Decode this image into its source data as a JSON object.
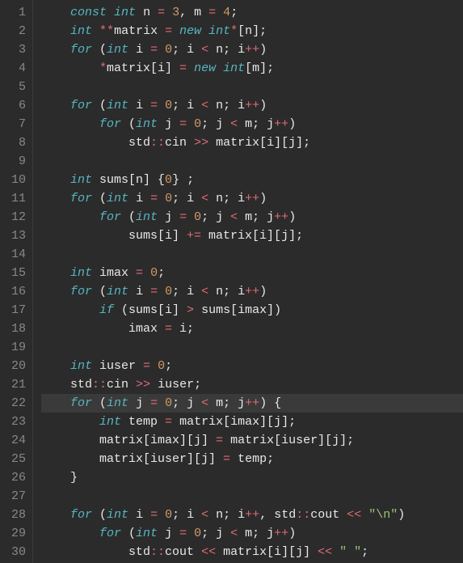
{
  "code": {
    "line_count": 30,
    "highlighted_line": 22,
    "lines": [
      [
        [
          "pun",
          "    "
        ],
        [
          "kw",
          "const"
        ],
        [
          "pun",
          " "
        ],
        [
          "kw",
          "int"
        ],
        [
          "pun",
          " n "
        ],
        [
          "op",
          "="
        ],
        [
          "pun",
          " "
        ],
        [
          "num",
          "3"
        ],
        [
          "pun",
          ", m "
        ],
        [
          "op",
          "="
        ],
        [
          "pun",
          " "
        ],
        [
          "num",
          "4"
        ],
        [
          "pun",
          ";"
        ]
      ],
      [
        [
          "pun",
          "    "
        ],
        [
          "kw",
          "int"
        ],
        [
          "pun",
          " "
        ],
        [
          "star",
          "**"
        ],
        [
          "pun",
          "matrix "
        ],
        [
          "op",
          "="
        ],
        [
          "pun",
          " "
        ],
        [
          "kw",
          "new"
        ],
        [
          "pun",
          " "
        ],
        [
          "kw",
          "int"
        ],
        [
          "star",
          "*"
        ],
        [
          "pun",
          "[n];"
        ]
      ],
      [
        [
          "pun",
          "    "
        ],
        [
          "kw",
          "for"
        ],
        [
          "pun",
          " ("
        ],
        [
          "kw",
          "int"
        ],
        [
          "pun",
          " i "
        ],
        [
          "op",
          "="
        ],
        [
          "pun",
          " "
        ],
        [
          "num",
          "0"
        ],
        [
          "pun",
          "; i "
        ],
        [
          "op",
          "<"
        ],
        [
          "pun",
          " n; i"
        ],
        [
          "op",
          "++"
        ],
        [
          "pun",
          ")"
        ]
      ],
      [
        [
          "pun",
          "        "
        ],
        [
          "star",
          "*"
        ],
        [
          "pun",
          "matrix[i] "
        ],
        [
          "op",
          "="
        ],
        [
          "pun",
          " "
        ],
        [
          "kw",
          "new"
        ],
        [
          "pun",
          " "
        ],
        [
          "kw",
          "int"
        ],
        [
          "pun",
          "[m];"
        ]
      ],
      [],
      [
        [
          "pun",
          "    "
        ],
        [
          "kw",
          "for"
        ],
        [
          "pun",
          " ("
        ],
        [
          "kw",
          "int"
        ],
        [
          "pun",
          " i "
        ],
        [
          "op",
          "="
        ],
        [
          "pun",
          " "
        ],
        [
          "num",
          "0"
        ],
        [
          "pun",
          "; i "
        ],
        [
          "op",
          "<"
        ],
        [
          "pun",
          " n; i"
        ],
        [
          "op",
          "++"
        ],
        [
          "pun",
          ")"
        ]
      ],
      [
        [
          "pun",
          "        "
        ],
        [
          "kw",
          "for"
        ],
        [
          "pun",
          " ("
        ],
        [
          "kw",
          "int"
        ],
        [
          "pun",
          " j "
        ],
        [
          "op",
          "="
        ],
        [
          "pun",
          " "
        ],
        [
          "num",
          "0"
        ],
        [
          "pun",
          "; j "
        ],
        [
          "op",
          "<"
        ],
        [
          "pun",
          " m; j"
        ],
        [
          "op",
          "++"
        ],
        [
          "pun",
          ")"
        ]
      ],
      [
        [
          "pun",
          "            std"
        ],
        [
          "op",
          "::"
        ],
        [
          "pun",
          "cin "
        ],
        [
          "op",
          ">>"
        ],
        [
          "pun",
          " matrix[i][j];"
        ]
      ],
      [],
      [
        [
          "pun",
          "    "
        ],
        [
          "kw",
          "int"
        ],
        [
          "id",
          " sums[n] {"
        ],
        [
          "num",
          "0"
        ],
        [
          "id",
          "} ;"
        ]
      ],
      [
        [
          "pun",
          "    "
        ],
        [
          "kw",
          "for"
        ],
        [
          "pun",
          " ("
        ],
        [
          "kw",
          "int"
        ],
        [
          "pun",
          " i "
        ],
        [
          "op",
          "="
        ],
        [
          "pun",
          " "
        ],
        [
          "num",
          "0"
        ],
        [
          "pun",
          "; i "
        ],
        [
          "op",
          "<"
        ],
        [
          "pun",
          " n; i"
        ],
        [
          "op",
          "++"
        ],
        [
          "pun",
          ")"
        ]
      ],
      [
        [
          "pun",
          "        "
        ],
        [
          "kw",
          "for"
        ],
        [
          "pun",
          " ("
        ],
        [
          "kw",
          "int"
        ],
        [
          "pun",
          " j "
        ],
        [
          "op",
          "="
        ],
        [
          "pun",
          " "
        ],
        [
          "num",
          "0"
        ],
        [
          "pun",
          "; j "
        ],
        [
          "op",
          "<"
        ],
        [
          "pun",
          " m; j"
        ],
        [
          "op",
          "++"
        ],
        [
          "pun",
          ")"
        ]
      ],
      [
        [
          "pun",
          "            sums[i] "
        ],
        [
          "op",
          "+="
        ],
        [
          "pun",
          " matrix[i][j];"
        ]
      ],
      [],
      [
        [
          "pun",
          "    "
        ],
        [
          "kw",
          "int"
        ],
        [
          "pun",
          " imax "
        ],
        [
          "op",
          "="
        ],
        [
          "pun",
          " "
        ],
        [
          "num",
          "0"
        ],
        [
          "pun",
          ";"
        ]
      ],
      [
        [
          "pun",
          "    "
        ],
        [
          "kw",
          "for"
        ],
        [
          "pun",
          " ("
        ],
        [
          "kw",
          "int"
        ],
        [
          "pun",
          " i "
        ],
        [
          "op",
          "="
        ],
        [
          "pun",
          " "
        ],
        [
          "num",
          "0"
        ],
        [
          "pun",
          "; i "
        ],
        [
          "op",
          "<"
        ],
        [
          "pun",
          " n; i"
        ],
        [
          "op",
          "++"
        ],
        [
          "pun",
          ")"
        ]
      ],
      [
        [
          "pun",
          "        "
        ],
        [
          "kw",
          "if"
        ],
        [
          "pun",
          " (sums[i] "
        ],
        [
          "op",
          ">"
        ],
        [
          "pun",
          " sums[imax])"
        ]
      ],
      [
        [
          "pun",
          "            imax "
        ],
        [
          "op",
          "="
        ],
        [
          "pun",
          " i;"
        ]
      ],
      [],
      [
        [
          "pun",
          "    "
        ],
        [
          "kw",
          "int"
        ],
        [
          "pun",
          " iuser "
        ],
        [
          "op",
          "="
        ],
        [
          "pun",
          " "
        ],
        [
          "num",
          "0"
        ],
        [
          "pun",
          ";"
        ]
      ],
      [
        [
          "pun",
          "    std"
        ],
        [
          "op",
          "::"
        ],
        [
          "pun",
          "cin "
        ],
        [
          "op",
          ">>"
        ],
        [
          "pun",
          " iuser;"
        ]
      ],
      [
        [
          "pun",
          "    "
        ],
        [
          "kw",
          "for"
        ],
        [
          "pun",
          " ("
        ],
        [
          "kw",
          "int"
        ],
        [
          "pun",
          " j "
        ],
        [
          "op",
          "="
        ],
        [
          "pun",
          " "
        ],
        [
          "num",
          "0"
        ],
        [
          "pun",
          "; j "
        ],
        [
          "op",
          "<"
        ],
        [
          "pun",
          " m; j"
        ],
        [
          "op",
          "++"
        ],
        [
          "pun",
          ") {"
        ]
      ],
      [
        [
          "pun",
          "        "
        ],
        [
          "kw",
          "int"
        ],
        [
          "pun",
          " temp "
        ],
        [
          "op",
          "="
        ],
        [
          "pun",
          " matrix[imax][j];"
        ]
      ],
      [
        [
          "pun",
          "        matrix[imax][j] "
        ],
        [
          "op",
          "="
        ],
        [
          "pun",
          " matrix[iuser][j];"
        ]
      ],
      [
        [
          "pun",
          "        matrix[iuser][j] "
        ],
        [
          "op",
          "="
        ],
        [
          "pun",
          " temp;"
        ]
      ],
      [
        [
          "pun",
          "    }"
        ]
      ],
      [],
      [
        [
          "pun",
          "    "
        ],
        [
          "kw",
          "for"
        ],
        [
          "pun",
          " ("
        ],
        [
          "kw",
          "int"
        ],
        [
          "pun",
          " i "
        ],
        [
          "op",
          "="
        ],
        [
          "pun",
          " "
        ],
        [
          "num",
          "0"
        ],
        [
          "pun",
          "; i "
        ],
        [
          "op",
          "<"
        ],
        [
          "pun",
          " n; i"
        ],
        [
          "op",
          "++"
        ],
        [
          "pun",
          ", std"
        ],
        [
          "op",
          "::"
        ],
        [
          "pun",
          "cout "
        ],
        [
          "op",
          "<<"
        ],
        [
          "pun",
          " "
        ],
        [
          "str",
          "\"\\n\""
        ],
        [
          "pun",
          ")"
        ]
      ],
      [
        [
          "pun",
          "        "
        ],
        [
          "kw",
          "for"
        ],
        [
          "pun",
          " ("
        ],
        [
          "kw",
          "int"
        ],
        [
          "pun",
          " j "
        ],
        [
          "op",
          "="
        ],
        [
          "pun",
          " "
        ],
        [
          "num",
          "0"
        ],
        [
          "pun",
          "; j "
        ],
        [
          "op",
          "<"
        ],
        [
          "pun",
          " m; j"
        ],
        [
          "op",
          "++"
        ],
        [
          "pun",
          ")"
        ]
      ],
      [
        [
          "pun",
          "            std"
        ],
        [
          "op",
          "::"
        ],
        [
          "pun",
          "cout "
        ],
        [
          "op",
          "<<"
        ],
        [
          "pun",
          " matrix[i][j] "
        ],
        [
          "op",
          "<<"
        ],
        [
          "pun",
          " "
        ],
        [
          "str",
          "\" \""
        ],
        [
          "pun",
          ";"
        ]
      ]
    ]
  }
}
